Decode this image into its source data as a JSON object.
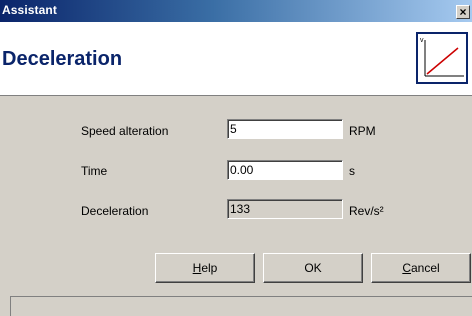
{
  "window": {
    "title": "Assistant",
    "close_glyph": "×"
  },
  "header": {
    "title": "Deceleration",
    "icon": "speed-ramp-graph-icon",
    "icon_axis_label": "v"
  },
  "form": {
    "speed_alteration": {
      "label": "Speed alteration",
      "value": "5",
      "unit": "RPM"
    },
    "time": {
      "label": "Time",
      "value": "0.00",
      "unit": "s"
    },
    "deceleration": {
      "label": "Deceleration",
      "value": "133",
      "unit": "Rev/s²"
    }
  },
  "buttons": {
    "help": {
      "mnemonic": "H",
      "rest": "elp"
    },
    "ok": "OK",
    "cancel": {
      "mnemonic": "C",
      "rest": "ancel"
    }
  },
  "colors": {
    "title_bar": "#0a246a",
    "header_title": "#0a246a",
    "graph_line": "#cc0000",
    "dialog_face": "#d4d0c8"
  }
}
